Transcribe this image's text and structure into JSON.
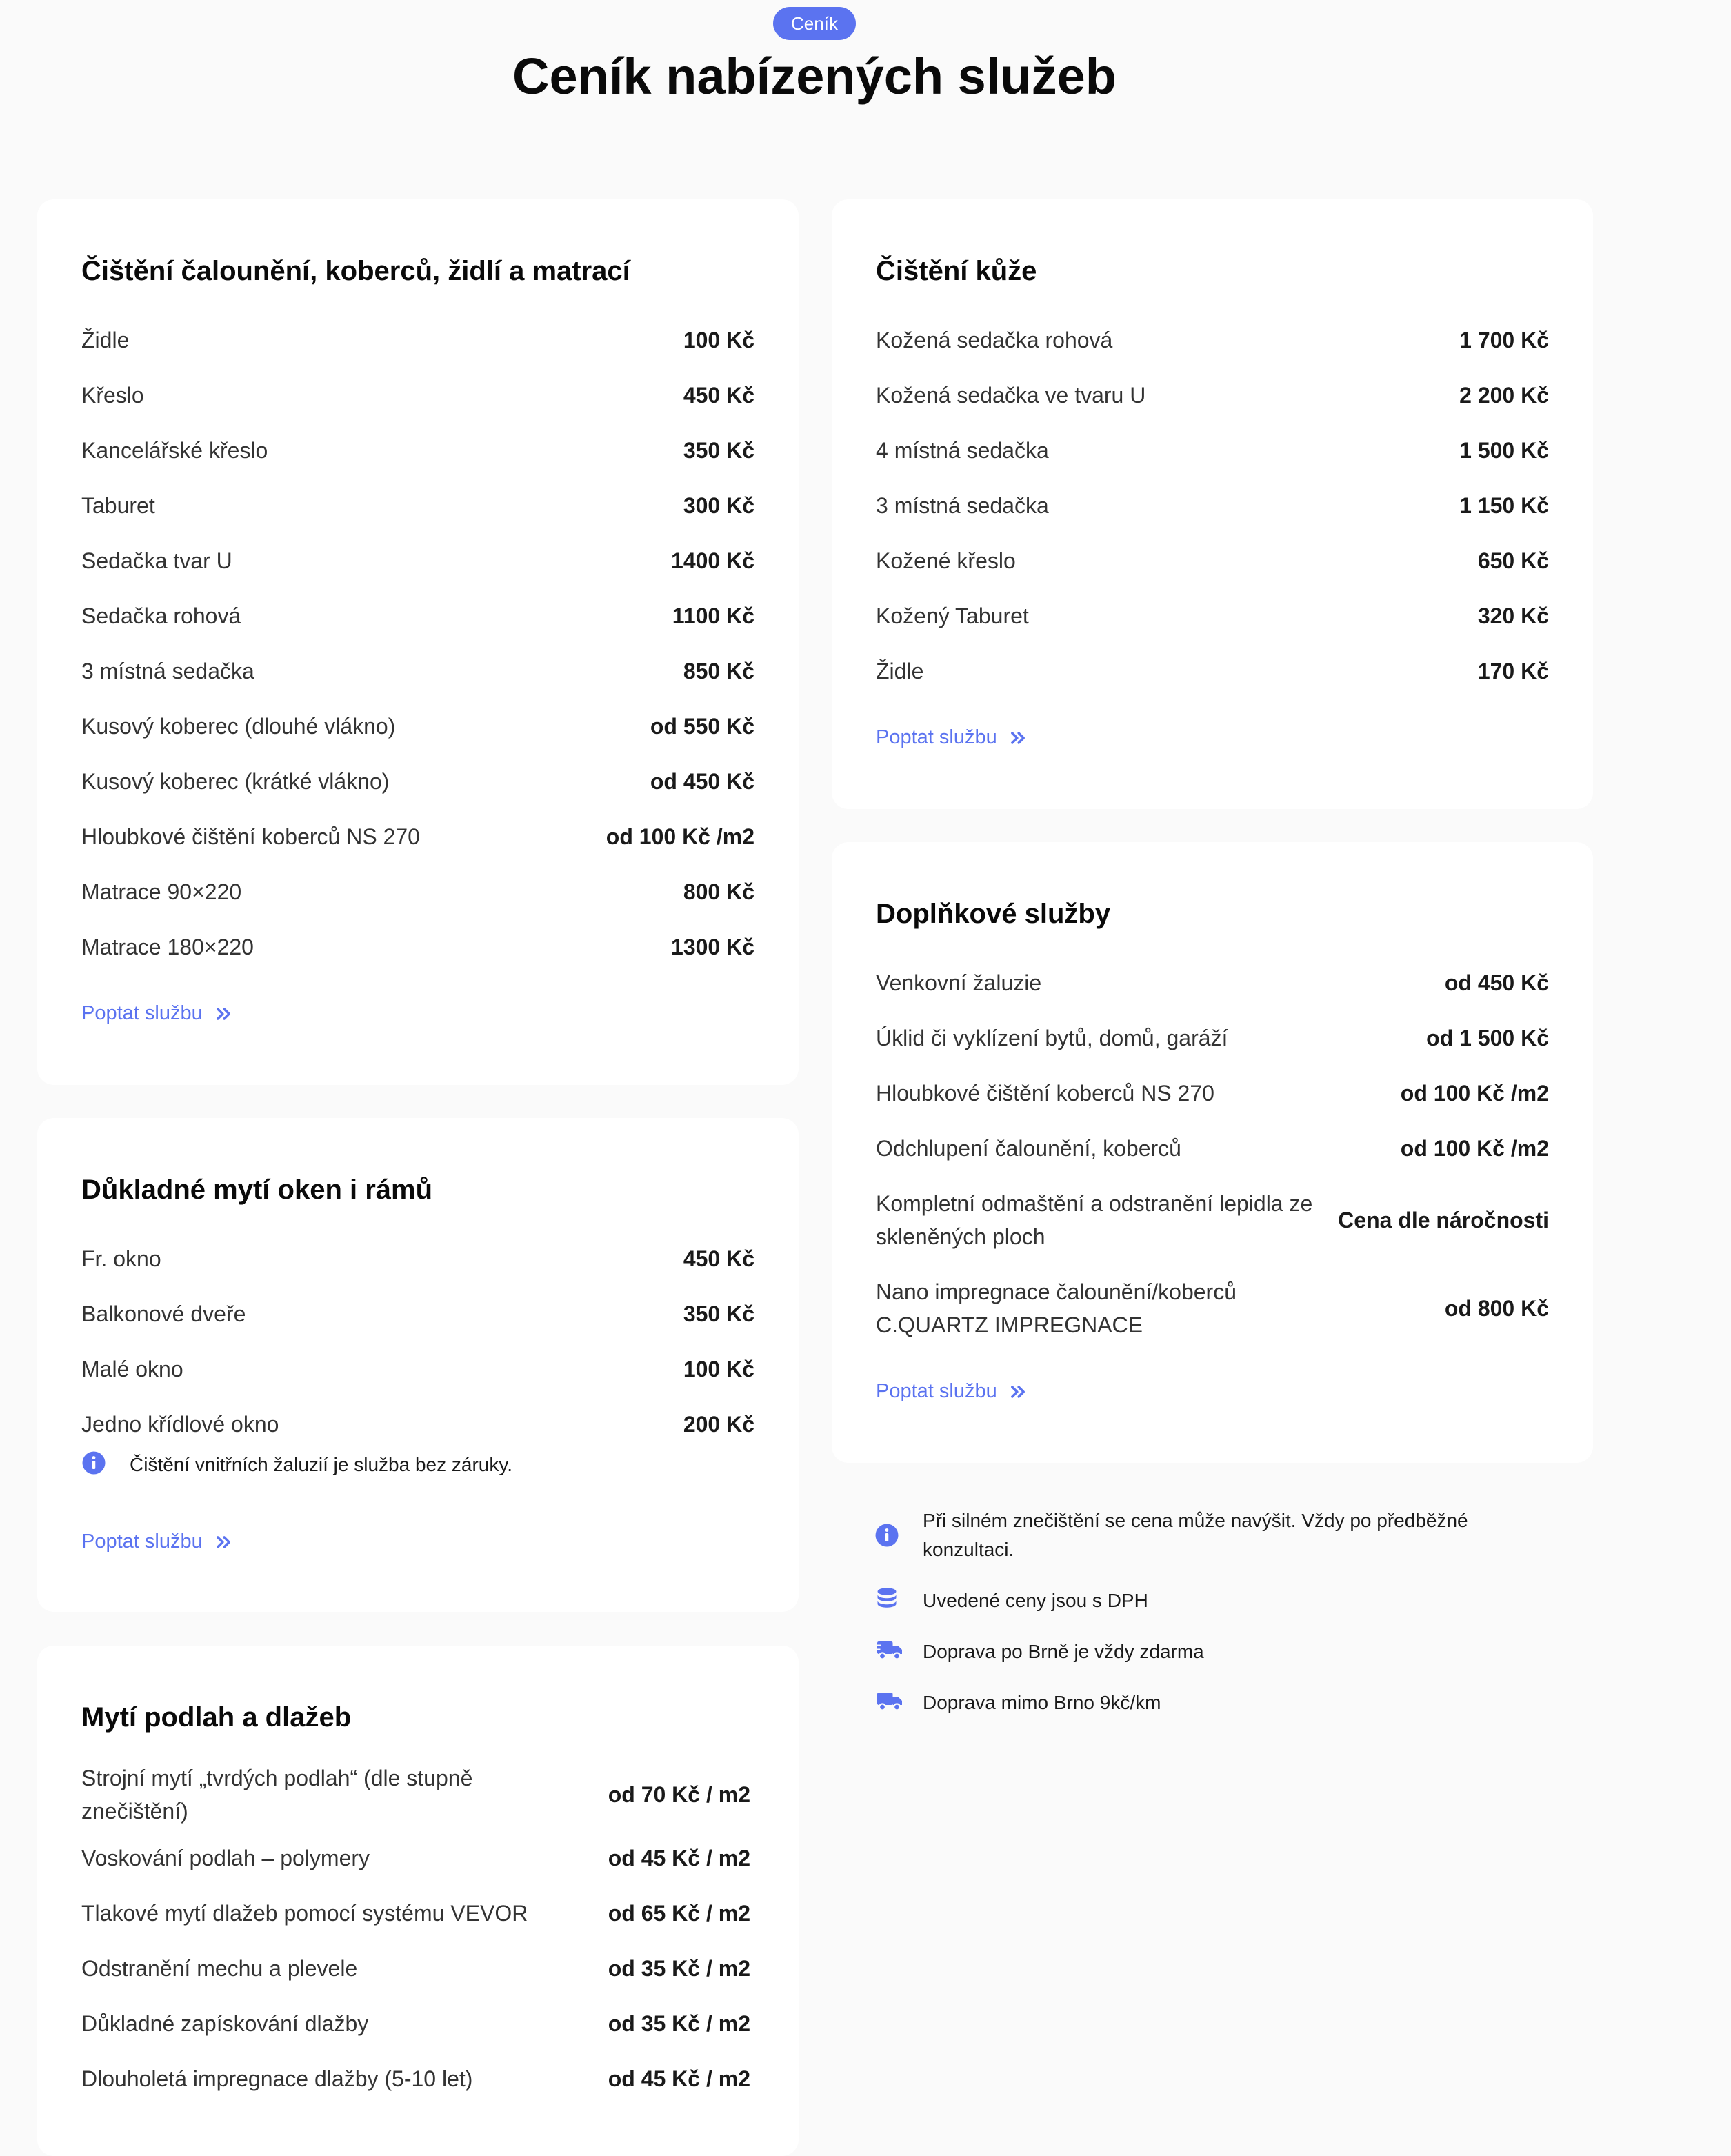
{
  "header": {
    "badge": "Ceník",
    "title": "Ceník nabízených služeb"
  },
  "colors": {
    "accent": "#5b73f0",
    "card": "#ffffff",
    "background": "#fafafa"
  },
  "cta_label": "Poptat službu",
  "sections": {
    "upholstery": {
      "title": "Čištění čalounění, koberců, židlí a matrací",
      "items": [
        {
          "name": "Židle",
          "price": "100 Kč"
        },
        {
          "name": "Křeslo",
          "price": "450 Kč"
        },
        {
          "name": "Kancelářské křeslo",
          "price": "350 Kč"
        },
        {
          "name": "Taburet",
          "price": "300 Kč"
        },
        {
          "name": "Sedačka tvar U",
          "price": "1400 Kč"
        },
        {
          "name": "Sedačka rohová",
          "price": "1100 Kč"
        },
        {
          "name": "3 místná sedačka",
          "price": "850 Kč"
        },
        {
          "name": "Kusový koberec (dlouhé vlákno)",
          "price": "od 550 Kč"
        },
        {
          "name": "Kusový koberec (krátké vlákno)",
          "price": "od 450 Kč"
        },
        {
          "name": "Hloubkové čištění koberců NS 270",
          "price": "od 100 Kč /m2"
        },
        {
          "name": "Matrace 90×220",
          "price": "800 Kč"
        },
        {
          "name": "Matrace 180×220",
          "price": "1300 Kč"
        }
      ]
    },
    "leather": {
      "title": "Čištění kůže",
      "items": [
        {
          "name": "Kožená sedačka rohová",
          "price": "1 700 Kč"
        },
        {
          "name": "Kožená sedačka ve tvaru U",
          "price": "2 200 Kč"
        },
        {
          "name": "4 místná sedačka",
          "price": "1 500 Kč"
        },
        {
          "name": "3 místná sedačka",
          "price": "1 150 Kč"
        },
        {
          "name": "Kožené křeslo",
          "price": "650 Kč"
        },
        {
          "name": "Kožený Taburet",
          "price": "320 Kč"
        },
        {
          "name": "Židle",
          "price": "170 Kč"
        }
      ]
    },
    "windows": {
      "title": "Důkladné mytí oken i rámů",
      "items": [
        {
          "name": "Fr. okno",
          "price": "450 Kč"
        },
        {
          "name": "Balkonové dveře",
          "price": "350 Kč"
        },
        {
          "name": "Malé okno",
          "price": "100 Kč"
        },
        {
          "name": "Jedno křídlové okno",
          "price": "200 Kč"
        }
      ],
      "note": "Čištění vnitřních žaluzií je služba bez záruky."
    },
    "extras": {
      "title": "Doplňkové služby",
      "items": [
        {
          "name": "Venkovní žaluzie",
          "price": "od 450 Kč"
        },
        {
          "name": "Úklid či vyklízení bytů, domů, garáží",
          "price": "od 1 500 Kč"
        },
        {
          "name": "Hloubkové čištění koberců NS 270",
          "price": "od 100 Kč /m2"
        },
        {
          "name": "Odchlupení čalounění, koberců",
          "price": "od 100 Kč /m2"
        },
        {
          "name": "Kompletní odmaštění a odstranění lepidla ze skleněných ploch",
          "price": "Cena dle náročnosti"
        },
        {
          "name": "Nano impregnace čalounění/koberců C.QUARTZ IMPREGNACE",
          "price": "od 800 Kč"
        }
      ]
    },
    "floors": {
      "title": "Mytí podlah a dlažeb",
      "items": [
        {
          "name": "Strojní mytí „tvrdých podlah“ (dle stupně znečištění)",
          "price": "od 70 Kč / m2"
        },
        {
          "name": "Voskování podlah – polymery",
          "price": "od 45 Kč / m2"
        },
        {
          "name": "Tlakové mytí dlažeb pomocí systému VEVOR",
          "price": "od 65 Kč / m2"
        },
        {
          "name": "Odstranění mechu a plevele",
          "price": "od 35 Kč / m2"
        },
        {
          "name": "Důkladné zapískování dlažby",
          "price": "od 35 Kč / m2"
        },
        {
          "name": "Dlouholetá impregnace dlažby (5-10 let)",
          "price": "od 45 Kč / m2"
        }
      ]
    }
  },
  "info_notes": [
    {
      "icon": "info-icon",
      "text": "Při silném znečištění se cena může navýšit. Vždy po předběžné konzultaci."
    },
    {
      "icon": "coins-icon",
      "text": "Uvedené ceny jsou s DPH"
    },
    {
      "icon": "truck-fast-icon",
      "text": "Doprava po Brně je vždy zdarma"
    },
    {
      "icon": "truck-icon",
      "text": "Doprava mimo Brno 9kč/km"
    }
  ]
}
